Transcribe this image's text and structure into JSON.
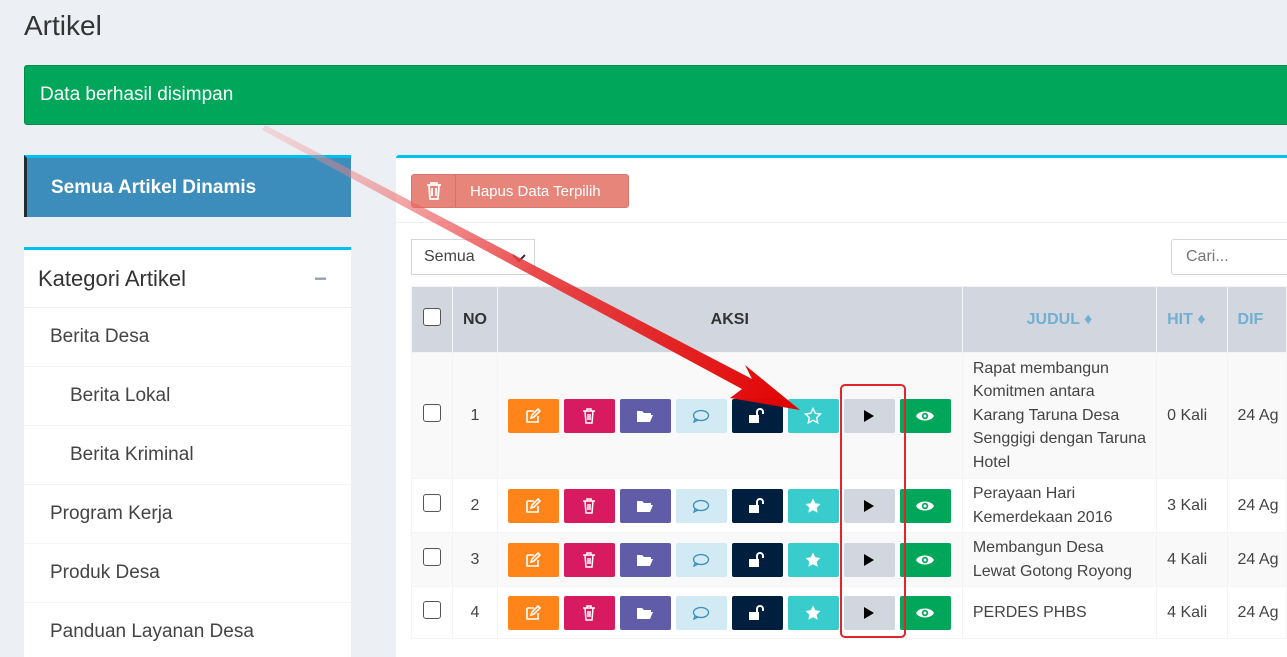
{
  "page": {
    "title": "Artikel"
  },
  "alert": {
    "message": "Data berhasil disimpan"
  },
  "sidebar": {
    "active_menu": "Semua Artikel Dinamis",
    "category_title": "Kategori Artikel",
    "collapse_symbol": "−",
    "categories": [
      {
        "label": "Berita Desa",
        "level": 0
      },
      {
        "label": "Berita Lokal",
        "level": 1
      },
      {
        "label": "Berita Kriminal",
        "level": 1
      },
      {
        "label": "Program Kerja",
        "level": 0
      },
      {
        "label": "Produk Desa",
        "level": 0
      },
      {
        "label": "Panduan Layanan Desa",
        "level": 0
      }
    ]
  },
  "toolbar": {
    "delete_selected_label": "Hapus Data Terpilih"
  },
  "filter": {
    "selected": "Semua",
    "chevron": "⌄"
  },
  "search": {
    "placeholder": "Cari..."
  },
  "table": {
    "headers": {
      "no": "NO",
      "aksi": "AKSI",
      "judul": "JUDUL",
      "hit": "HIT",
      "tanggal": "DIF"
    },
    "sort_symbol": "♦",
    "rows": [
      {
        "no": "1",
        "judul": "Rapat membangun Komitmen antara Karang Taruna Desa Senggigi dengan Taruna Hotel",
        "hit": "0 Kali",
        "tanggal": "24 Ag",
        "featured": false
      },
      {
        "no": "2",
        "judul": "Perayaan Hari Kemerdekaan 2016",
        "hit": "3 Kali",
        "tanggal": "24 Ag",
        "featured": true
      },
      {
        "no": "3",
        "judul": "Membangun Desa Lewat Gotong Royong",
        "hit": "4 Kali",
        "tanggal": "24 Ag",
        "featured": true
      },
      {
        "no": "4",
        "judul": "PERDES PHBS",
        "hit": "4 Kali",
        "tanggal": "24 Ag",
        "featured": true
      }
    ]
  },
  "colors": {
    "alert_green": "#00a65a",
    "primary_blue": "#3c8dbc",
    "box_border": "#00c0ef",
    "highlight_red": "#e0262a"
  },
  "icons": {
    "edit": "edit-icon",
    "delete": "trash-icon",
    "folder": "folder-open-icon",
    "comment": "comment-icon",
    "lock": "unlock-icon",
    "star": "star-icon",
    "play": "play-icon",
    "view": "eye-icon"
  }
}
